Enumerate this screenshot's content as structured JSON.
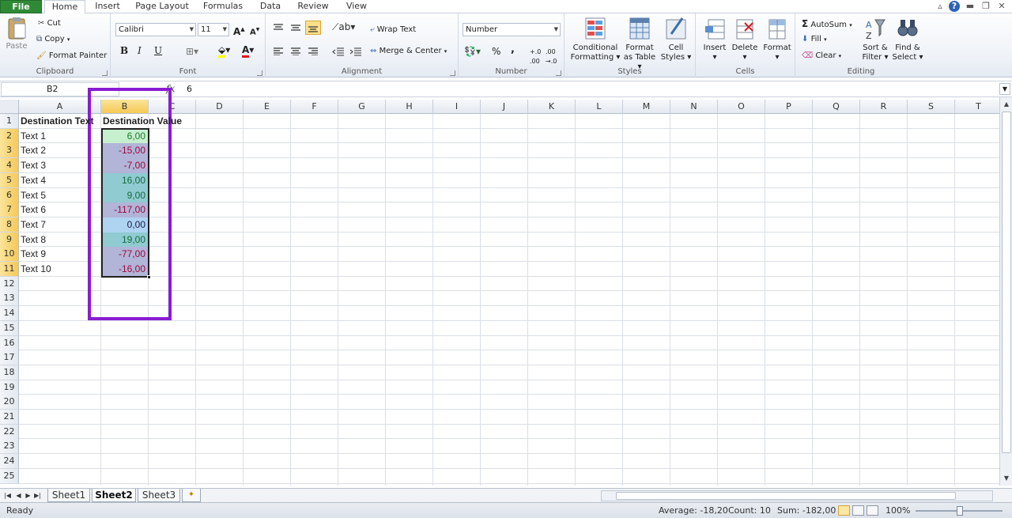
{
  "tabs": {
    "file": "File",
    "home": "Home",
    "insert": "Insert",
    "page_layout": "Page Layout",
    "formulas": "Formulas",
    "data": "Data",
    "review": "Review",
    "view": "View"
  },
  "clipboard": {
    "paste": "Paste",
    "cut": "Cut",
    "copy": "Copy",
    "format_painter": "Format Painter",
    "label": "Clipboard"
  },
  "font": {
    "name": "Calibri",
    "size": "11",
    "bold": "B",
    "italic": "I",
    "underline": "U",
    "label": "Font"
  },
  "alignment": {
    "wrap_text": "Wrap Text",
    "merge_center": "Merge & Center",
    "label": "Alignment"
  },
  "number": {
    "format": "Number",
    "percent": "%",
    "comma": ",",
    "label": "Number"
  },
  "styles": {
    "cond_fmt_1": "Conditional",
    "cond_fmt_2": "Formatting",
    "fmt_table_1": "Format",
    "fmt_table_2": "as Table",
    "cell_styles_1": "Cell",
    "cell_styles_2": "Styles",
    "label": "Styles"
  },
  "cells": {
    "insert": "Insert",
    "delete": "Delete",
    "format": "Format",
    "label": "Cells"
  },
  "editing": {
    "autosum": "AutoSum",
    "fill": "Fill",
    "clear": "Clear",
    "sort_1": "Sort &",
    "sort_2": "Filter",
    "find_1": "Find &",
    "find_2": "Select",
    "label": "Editing"
  },
  "formula_bar": {
    "name_box": "B2",
    "fx": "fx",
    "value": "6"
  },
  "columns": [
    "A",
    "B",
    "C",
    "D",
    "E",
    "F",
    "G",
    "H",
    "I",
    "J",
    "K",
    "L",
    "M",
    "N",
    "O",
    "P",
    "Q",
    "R",
    "S",
    "T"
  ],
  "rows": [
    "1",
    "2",
    "3",
    "4",
    "5",
    "6",
    "7",
    "8",
    "9",
    "10",
    "11",
    "12",
    "13",
    "14",
    "15",
    "16",
    "17",
    "18",
    "19",
    "20",
    "21",
    "22",
    "23",
    "24",
    "25"
  ],
  "cells_data": {
    "a1": "Destination Text",
    "b1": "Destination Value",
    "a": [
      "Text 1",
      "Text 2",
      "Text 3",
      "Text 4",
      "Text 5",
      "Text 6",
      "Text 7",
      "Text 8",
      "Text 9",
      "Text 10"
    ],
    "b": [
      "6,00",
      "-15,00",
      "-7,00",
      "16,00",
      "9,00",
      "-117,00",
      "0,00",
      "19,00",
      "-77,00",
      "-16,00"
    ]
  },
  "cell_colors": {
    "fills": [
      "#c6efce",
      "#b2b4d8",
      "#b2b4d8",
      "#8fcbd1",
      "#8fcbd1",
      "#b2b4d8",
      "#aed4f2",
      "#8fcbd1",
      "#b2b4d8",
      "#b2b4d8"
    ],
    "text": [
      "#1e7a2e",
      "#9c0b3a",
      "#9c0b3a",
      "#156b3d",
      "#156b3d",
      "#9c0b3a",
      "#1a1a4a",
      "#156b3d",
      "#9c0b3a",
      "#9c0b3a"
    ]
  },
  "sheets": [
    "Sheet1",
    "Sheet2",
    "Sheet3"
  ],
  "status": {
    "ready": "Ready",
    "average": "Average: -18,20",
    "count": "Count: 10",
    "sum": "Sum: -182,00",
    "zoom": "100%"
  },
  "accent": {
    "highlight_box": "#8a1bd2",
    "file_tab": "#2f8a36",
    "selected_header": "#f5c955"
  }
}
